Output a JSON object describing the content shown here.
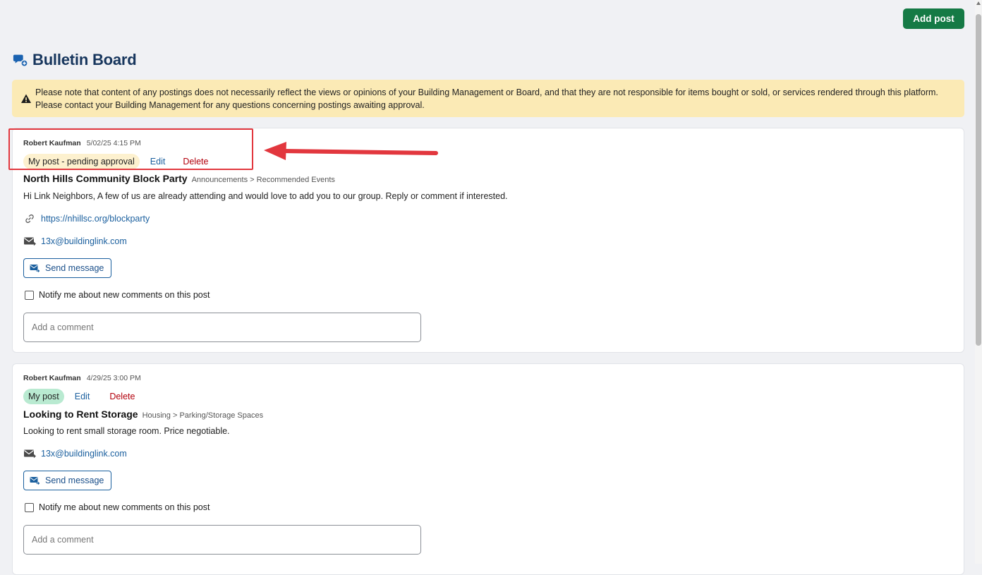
{
  "header": {
    "add_post_label": "Add post",
    "page_title": "Bulletin Board"
  },
  "notice": {
    "line1": "Please note that content of any postings does not necessarily reflect the views or opinions of your Building Management or Board, and that they are not responsible for items bought or sold, or services rendered through this platform.",
    "line2": "Please contact your Building Management for any questions concerning postings awaiting approval."
  },
  "posts": [
    {
      "author": "Robert Kaufman",
      "date": "5/02/25 4:15 PM",
      "status": "My post - pending approval",
      "edit_label": "Edit",
      "delete_label": "Delete",
      "title": "North Hills Community Block Party",
      "category": "Announcements > Recommended Events",
      "body": "Hi Link Neighbors, A few of us are already attending and would love to add you to our group. Reply or comment if interested.",
      "link": "https://nhillsc.org/blockparty",
      "email": "13x@buildinglink.com",
      "send_label": "Send message",
      "notify_label": "Notify me about new comments on this post",
      "comment_placeholder": "Add a comment"
    },
    {
      "author": "Robert Kaufman",
      "date": "4/29/25 3:00 PM",
      "status": "My post",
      "edit_label": "Edit",
      "delete_label": "Delete",
      "title": "Looking to Rent Storage",
      "category": "Housing > Parking/Storage Spaces",
      "body": "Looking to rent small storage room. Price negotiable.",
      "email": "13x@buildinglink.com",
      "send_label": "Send message",
      "notify_label": "Notify me about new comments on this post",
      "comment_placeholder": "Add a comment"
    }
  ],
  "colors": {
    "primary_green": "#157a45",
    "title_navy": "#17365d",
    "link_blue": "#1a5f9e",
    "delete_red": "#b3000c",
    "notice_bg": "#fbeab5",
    "pending_bg": "#fdf1cf",
    "mypost_bg": "#b9ead1",
    "annotation_red": "#e2373e"
  },
  "icons": {
    "title": "chat-bubbles-icon",
    "notice": "warning-triangle-icon",
    "link": "link-icon",
    "email": "email-icon",
    "send": "send-message-icon"
  }
}
